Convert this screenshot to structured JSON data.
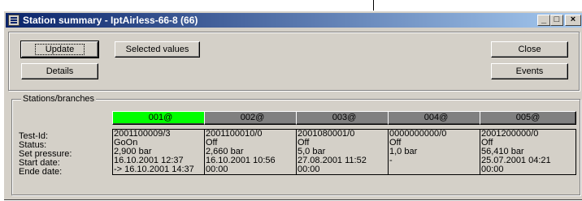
{
  "window": {
    "title": "Station summary - IptAirless-66-8 (66)"
  },
  "controls": {
    "minimize": "_",
    "maximize": "□",
    "close": "×"
  },
  "toolbar": {
    "update": "Update",
    "details": "Details",
    "selected_values": "Selected values",
    "close": "Close",
    "events": "Events"
  },
  "stations_group": {
    "legend": "Stations/branches",
    "field_labels": [
      "Test-Id:",
      "Status:",
      "Set pressure:",
      "Start date:",
      "Ende date:"
    ],
    "stations": [
      {
        "id": "001@",
        "active": true,
        "color": "#00ff00",
        "values": [
          "2001100009/3",
          "GoOn",
          "2,900 bar",
          "16.10.2001 12:37",
          "-> 16.10.2001 14:37"
        ]
      },
      {
        "id": "002@",
        "active": false,
        "color": "#808080",
        "values": [
          "2001100010/0",
          "Off",
          "2,660 bar",
          "16.10.2001 10:56",
          "00:00"
        ]
      },
      {
        "id": "003@",
        "active": false,
        "color": "#808080",
        "values": [
          "2001080001/0",
          "Off",
          "5,0 bar",
          "27.08.2001 11:52",
          "00:00"
        ]
      },
      {
        "id": "004@",
        "active": false,
        "color": "#808080",
        "values": [
          "0000000000/0",
          "Off",
          "1,0 bar",
          "-",
          ""
        ]
      },
      {
        "id": "005@",
        "active": false,
        "color": "#808080",
        "values": [
          "2001200000/0",
          "Off",
          "56,410 bar",
          "25.07.2001 04:21",
          "00:00"
        ]
      }
    ]
  }
}
